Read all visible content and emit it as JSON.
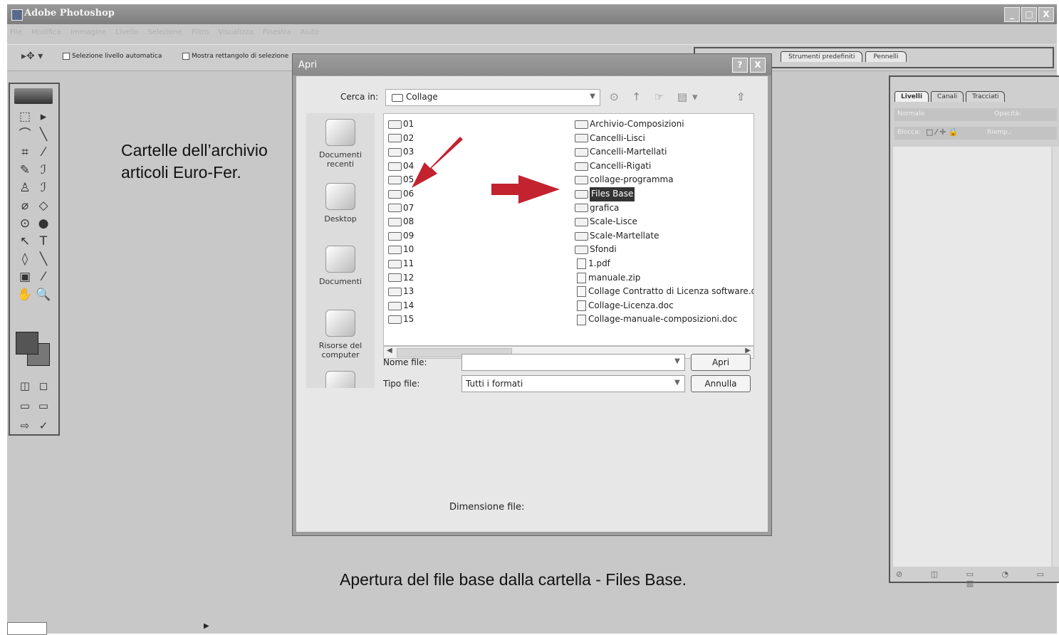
{
  "app": {
    "title": "Adobe Photoshop",
    "window_buttons": [
      "_",
      "□",
      "X"
    ],
    "menu": [
      "File",
      "Modifica",
      "Immagine",
      "Livello",
      "Selezione",
      "Filtro",
      "Visualizza",
      "Finestra",
      "Aiuto"
    ]
  },
  "options_bar": {
    "tool_icon": "move-tool-icon",
    "tool_glyph": "▸✥ ▾",
    "checkbox1": "Selezione livello automatica",
    "checkbox2": "Mostra rettangolo di selezione",
    "palette_tabs": [
      "Strumenti predefiniti",
      "Pennelli"
    ]
  },
  "toolbox": {
    "tools": [
      "⬚",
      "▸",
      "⌒",
      "╲",
      "⌗",
      "⁄",
      "✎",
      "ℐ",
      "♙",
      "ℐ",
      "⌀",
      "◇",
      "⊙",
      "●",
      "↖",
      "T",
      "◊",
      "╲",
      "▣",
      "⁄",
      "✋",
      "🔍"
    ],
    "bottom": [
      "◫",
      "◻",
      "▭",
      "▭",
      "⇨",
      "✓"
    ]
  },
  "annotations": {
    "left": "Cartelle dell’archivio articoli Euro-Fer.",
    "bottom": "Apertura del file base dalla cartella - Files Base."
  },
  "dialog": {
    "title": "Apri",
    "title_buttons": [
      "?",
      "X"
    ],
    "look_in_label": "Cerca in:",
    "look_in_value": "Collage",
    "nav_icons": "⊙ ↑ ☞ ▤▾",
    "nav_up": "⇧",
    "places": [
      "Documenti recenti",
      "Desktop",
      "Documenti",
      "Risorse del computer",
      ""
    ],
    "files_col1": [
      "01",
      "02",
      "03",
      "04",
      "05",
      "06",
      "07",
      "08",
      "09",
      "10",
      "11",
      "12",
      "13",
      "14",
      "15"
    ],
    "files_col2": [
      {
        "name": "Archivio-Composizioni",
        "kind": "folder"
      },
      {
        "name": "Cancelli-Lisci",
        "kind": "folder"
      },
      {
        "name": "Cancelli-Martellati",
        "kind": "folder"
      },
      {
        "name": "Cancelli-Rigati",
        "kind": "folder"
      },
      {
        "name": "collage-programma",
        "kind": "folder"
      },
      {
        "name": "Files Base",
        "kind": "folder",
        "selected": true
      },
      {
        "name": "grafica",
        "kind": "folder"
      },
      {
        "name": "Scale-Lisce",
        "kind": "folder"
      },
      {
        "name": "Scale-Martellate",
        "kind": "folder"
      },
      {
        "name": "Sfondi",
        "kind": "folder"
      },
      {
        "name": "1.pdf",
        "kind": "file"
      },
      {
        "name": "manuale.zip",
        "kind": "file"
      },
      {
        "name": "Collage Contratto di Licenza software.doc",
        "kind": "file"
      },
      {
        "name": "Collage-Licenza.doc",
        "kind": "file"
      },
      {
        "name": "Collage-manuale-composizioni.doc",
        "kind": "file"
      }
    ],
    "filename_label": "Nome file:",
    "filename_value": "",
    "filetype_label": "Tipo file:",
    "filetype_value": "Tutti i formati",
    "open_button": "Apri",
    "cancel_button": "Annulla",
    "file_size_label": "Dimensione file:"
  },
  "layers_panel": {
    "tabs": [
      "Livelli",
      "Canali",
      "Tracciati"
    ],
    "blend_mode": "Normale",
    "opacity_label": "Opacità:",
    "lock_label": "Blocca:",
    "lock_icons": "□ ⁄ ✛ 🔒",
    "fill_label": "Riemp.:",
    "bottom_icons": "⊘ ◫ ▭ ◔ ▭ ▥"
  },
  "status": {
    "arrow": "▶"
  },
  "colors": {
    "arrow_red": "#c2232f",
    "app_bg": "#c8c8c8",
    "dialog_bg": "#e7e7e7"
  }
}
